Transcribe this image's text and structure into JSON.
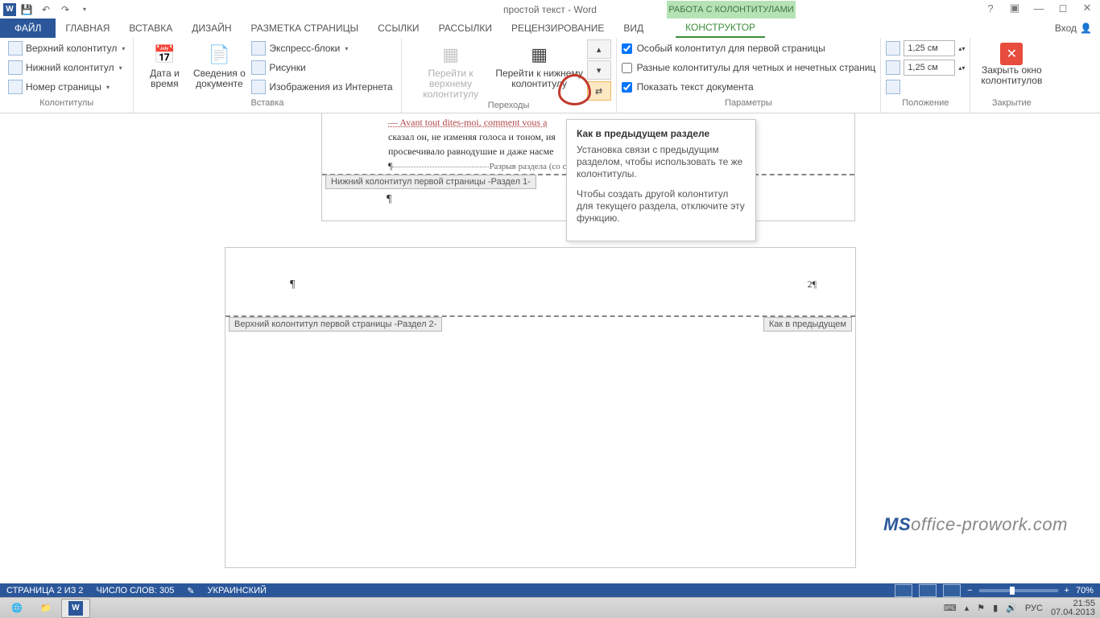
{
  "title": "простой текст - Word",
  "context_title": "РАБОТА С КОЛОНТИТУЛАМИ",
  "signin": "Вход",
  "tabs": [
    "ФАЙЛ",
    "ГЛАВНАЯ",
    "ВСТАВКА",
    "ДИЗАЙН",
    "РАЗМЕТКА СТРАНИЦЫ",
    "ССЫЛКИ",
    "РАССЫЛКИ",
    "РЕЦЕНЗИРОВАНИЕ",
    "ВИД",
    "КОНСТРУКТОР"
  ],
  "ribbon": {
    "groups": {
      "hf": {
        "label": "Колонтитулы",
        "items": [
          "Верхний колонтитул",
          "Нижний колонтитул",
          "Номер страницы"
        ]
      },
      "insert": {
        "label": "Вставка",
        "date": "Дата и время",
        "docinfo": "Сведения о документе",
        "quick": "Экспресс-блоки",
        "pict": "Рисунки",
        "online": "Изображения из Интернета"
      },
      "nav": {
        "label": "Переходы",
        "gotoHeader": "Перейти к верхнему колонтитулу",
        "gotoFooter": "Перейти к нижнему колонтитулу"
      },
      "options": {
        "label": "Параметры",
        "first": "Особый колонтитул для первой страницы",
        "oddeven": "Разные колонтитулы для четных и нечетных страниц",
        "showdoc": "Показать текст документа"
      },
      "position": {
        "label": "Положение",
        "top": "1,25 см",
        "bottom": "1,25 см"
      },
      "close": {
        "label": "Закрытие",
        "btn": "Закрыть окно колонтитулов"
      }
    }
  },
  "tooltip": {
    "title": "Как в предыдущем разделе",
    "p1": "Установка связи с предыдущим разделом, чтобы использовать те же колонтитулы.",
    "p2": "Чтобы создать другой колонтитул для текущего раздела, отключите эту функцию."
  },
  "document": {
    "body_line1": "— Avant tout dites-moi, comment vous a",
    "body_line2": "сказал он, не изменяя голоса и тоном,                                                             ия",
    "body_line3": "просвечивало равнодушие и даже насме",
    "section_break": "Разрыв раздела (со с",
    "footer_tag": "Нижний колонтитул первой страницы -Раздел 1-",
    "header_tag": "Верхний колонтитул первой страницы -Раздел 2-",
    "same_as_prev": "Как в предыдущем",
    "pagenum": "2¶"
  },
  "statusbar": {
    "page": "СТРАНИЦА 2 ИЗ 2",
    "words": "ЧИСЛО СЛОВ: 305",
    "lang": "УКРАИНСКИЙ",
    "zoom": "70%"
  },
  "watermark_prefix": "MS",
  "watermark_rest": "office-prowork.com",
  "taskbar": {
    "lang": "РУС",
    "time": "21:55",
    "date": "07.04.2013"
  }
}
